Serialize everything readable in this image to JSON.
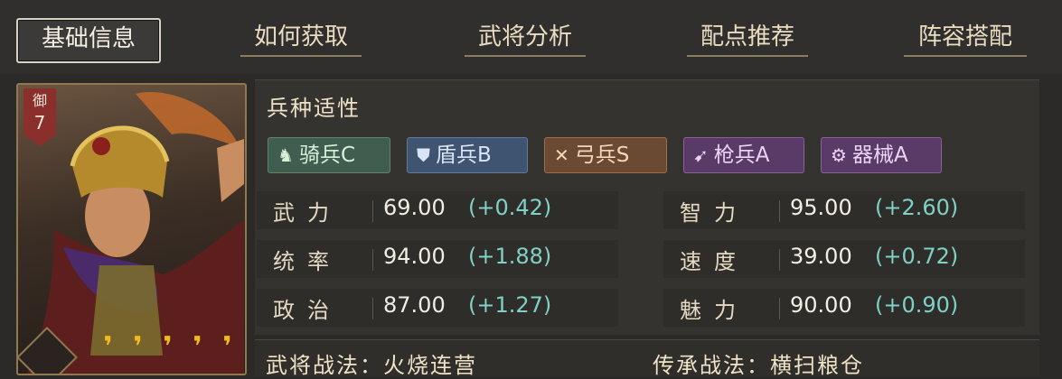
{
  "tabs": [
    {
      "label": "基础信息"
    },
    {
      "label": "如何获取"
    },
    {
      "label": "武将分析"
    },
    {
      "label": "配点推荐"
    },
    {
      "label": "阵容搭配"
    }
  ],
  "hero": {
    "badge_type": "御",
    "badge_cost": "7",
    "stars": 5
  },
  "troops": {
    "title": "兵种适性",
    "items": [
      {
        "label": "骑兵C",
        "icon": "horse-icon"
      },
      {
        "label": "盾兵B",
        "icon": "shield-icon"
      },
      {
        "label": "弓兵S",
        "icon": "bow-icon"
      },
      {
        "label": "枪兵A",
        "icon": "spear-icon"
      },
      {
        "label": "器械A",
        "icon": "siege-gear-icon"
      }
    ]
  },
  "stats": [
    {
      "label": "武力",
      "value": "69.00",
      "bonus": "(+0.42)"
    },
    {
      "label": "统率",
      "value": "94.00",
      "bonus": "(+1.88)"
    },
    {
      "label": "政治",
      "value": "87.00",
      "bonus": "(+1.27)"
    },
    {
      "label": "智力",
      "value": "95.00",
      "bonus": "(+2.60)"
    },
    {
      "label": "速度",
      "value": "39.00",
      "bonus": "(+0.72)"
    },
    {
      "label": "魅力",
      "value": "90.00",
      "bonus": "(+0.90)"
    }
  ],
  "bottom": {
    "left_text": "武将战法：火烧连营",
    "right_text": "传承战法：横扫粮仓"
  },
  "colors": {
    "accent_gold": "#f2b820",
    "bonus_teal": "#7fd0c5",
    "badge_red": "#8a2f2b"
  }
}
